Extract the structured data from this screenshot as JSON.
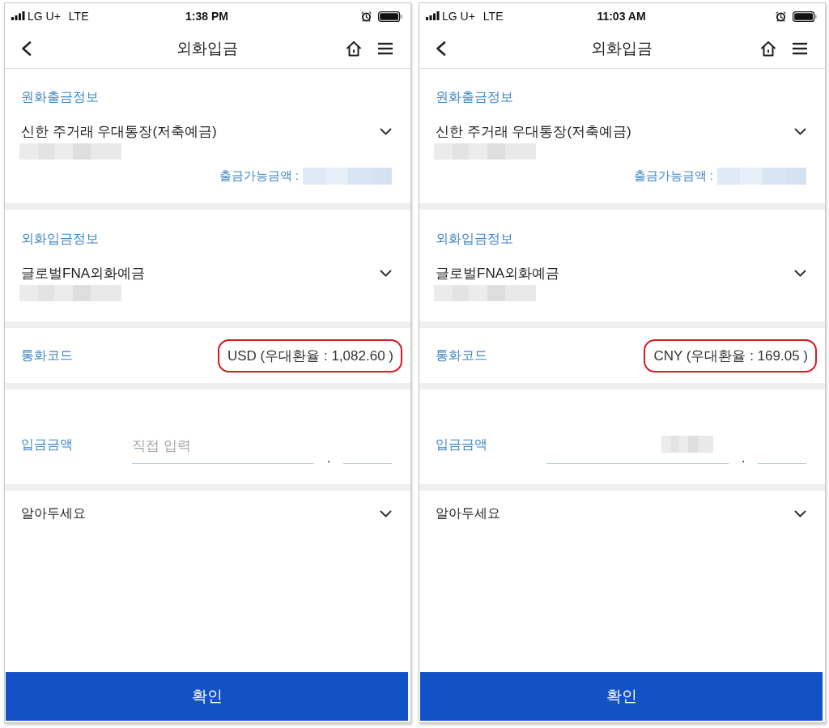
{
  "screens": [
    {
      "status_bar": {
        "carrier": "LG U+",
        "network": "LTE",
        "time": "1:38 PM"
      },
      "header": {
        "title": "외화입금"
      },
      "withdrawal": {
        "heading": "원화출금정보",
        "account": "신한 주거래 우대통장(저축예금)",
        "balance_label": "출금가능금액 :"
      },
      "deposit": {
        "heading": "외화입금정보",
        "account": "글로벌FNA외화예금"
      },
      "currency": {
        "label": "통화코드",
        "value": "USD (우대환율 : 1,082.60 )",
        "highlighted": true
      },
      "amount": {
        "label": "입금금액",
        "placeholder": "직접 입력",
        "value_redacted": false,
        "separator": "."
      },
      "notice": {
        "label": "알아두세요"
      },
      "confirm_button": {
        "label": "확인"
      }
    },
    {
      "status_bar": {
        "carrier": "LG U+",
        "network": "LTE",
        "time": "11:03 AM"
      },
      "header": {
        "title": "외화입금"
      },
      "withdrawal": {
        "heading": "원화출금정보",
        "account": "신한 주거래 우대통장(저축예금)",
        "balance_label": "출금가능금액 :"
      },
      "deposit": {
        "heading": "외화입금정보",
        "account": "글로벌FNA외화예금"
      },
      "currency": {
        "label": "통화코드",
        "value": "CNY (우대환율 : 169.05 )",
        "highlighted": true
      },
      "amount": {
        "label": "입금금액",
        "value_redacted": true,
        "separator": "."
      },
      "notice": {
        "label": "알아두세요"
      },
      "confirm_button": {
        "label": "확인"
      }
    }
  ]
}
